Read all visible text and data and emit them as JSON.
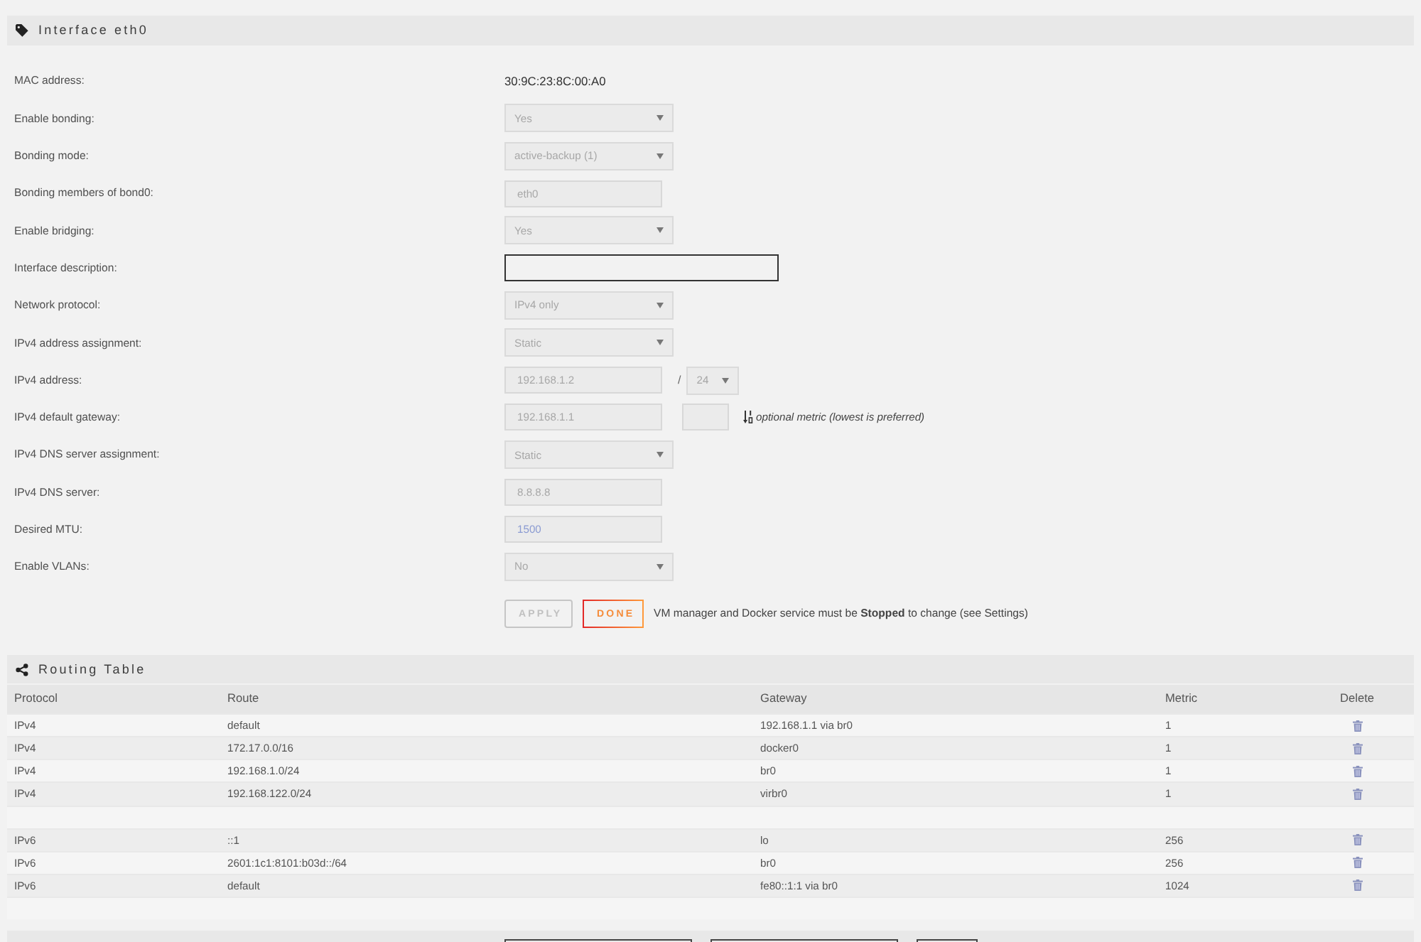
{
  "panel": {
    "title": "Interface eth0"
  },
  "settings": [
    {
      "label": "MAC address:",
      "kind": "text",
      "value": "30:9C:23:8C:00:A0"
    },
    {
      "label": "Enable bonding:",
      "kind": "select",
      "value": "Yes",
      "disabled": true
    },
    {
      "label": "Bonding mode:",
      "kind": "select",
      "value": "active-backup (1)",
      "disabled": true
    },
    {
      "label": "Bonding members of bond0:",
      "kind": "input",
      "value": "eth0",
      "disabled": true
    },
    {
      "label": "Enable bridging:",
      "kind": "select",
      "value": "Yes",
      "disabled": true
    },
    {
      "label": "Interface description:",
      "kind": "input",
      "disabled": false
    },
    {
      "label": "Network protocol:",
      "kind": "select",
      "value": "IPv4 only",
      "disabled": true
    },
    {
      "label": "IPv4 address assignment:",
      "kind": "select",
      "value": "Static",
      "disabled": true
    },
    {
      "label": "IPv4 address:",
      "kind": "address",
      "value": "192.168.1.2",
      "separator": "/",
      "prefix": "24",
      "disabled": true
    },
    {
      "label": "IPv4 default gateway:",
      "kind": "gateway",
      "value": "192.168.1.1",
      "hint": "optional metric (lowest is preferred)",
      "disabled": true
    },
    {
      "label": "IPv4 DNS server assignment:",
      "kind": "select",
      "value": "Static",
      "disabled": true
    },
    {
      "label": "IPv4 DNS server:",
      "kind": "input",
      "value": "8.8.8.8",
      "disabled": true
    },
    {
      "label": "Desired MTU:",
      "kind": "input",
      "placeholder": "1500",
      "disabled": true
    },
    {
      "label": "Enable VLANs:",
      "kind": "select",
      "value": "No",
      "disabled": true
    }
  ],
  "actions": {
    "buttons": [
      {
        "label": "APPLY",
        "disabled": true
      },
      {
        "label": "DONE",
        "disabled": false
      }
    ],
    "note": "VM manager and Docker service must be **Stopped** to change (see Settings)"
  },
  "routing": {
    "title": "Routing Table",
    "columns": [
      "Protocol",
      "Route",
      "Gateway",
      "Metric",
      "Delete"
    ],
    "groups": [
      {
        "rows": [
          {
            "protocol": "IPv4",
            "route": "default",
            "gateway": "192.168.1.1 via br0",
            "metric": "1"
          },
          {
            "protocol": "IPv4",
            "route": "172.17.0.0/16",
            "gateway": "docker0",
            "metric": "1"
          },
          {
            "protocol": "IPv4",
            "route": "192.168.1.0/24",
            "gateway": "br0",
            "metric": "1"
          },
          {
            "protocol": "IPv4",
            "route": "192.168.122.0/24",
            "gateway": "virbr0",
            "metric": "1"
          }
        ]
      },
      {
        "rows": [
          {
            "protocol": "IPv6",
            "route": "::1",
            "gateway": "lo",
            "metric": "256"
          },
          {
            "protocol": "IPv6",
            "route": "2601:1c1:8101:b03d::/64",
            "gateway": "br0",
            "metric": "256"
          },
          {
            "protocol": "IPv6",
            "route": "default",
            "gateway": "fe80::1:1 via br0",
            "metric": "1024"
          }
        ]
      }
    ]
  }
}
